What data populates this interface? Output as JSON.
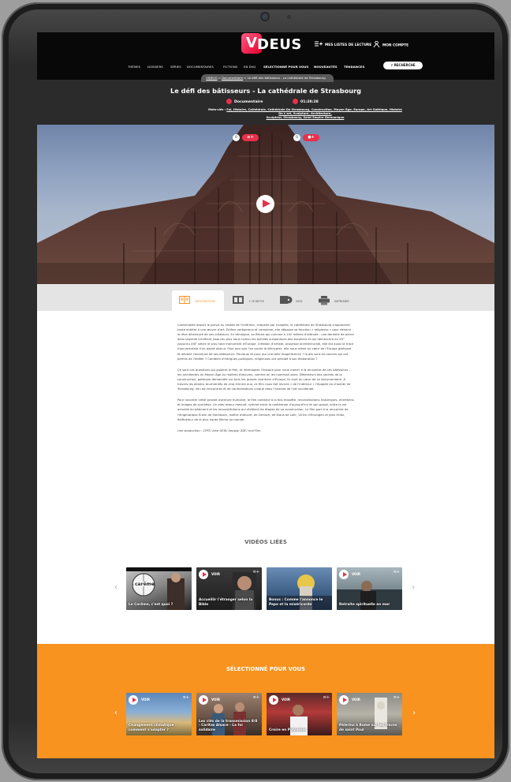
{
  "header": {
    "brand": "VIDEUS",
    "brand_letter": "V",
    "brand_rest": "DEUS",
    "playlists_label": "MES LISTES DE LECTURE",
    "account_label": "MON COMPTE",
    "search_label": "RECHERCHE",
    "nav": [
      "THÈMES",
      "DOSSIERS",
      "SÉRIES",
      "DOCUMENTAIRES",
      "FICTIONS",
      "EN DVD",
      "SÉLECTIONNÉ POUR VOUS",
      "NOUVEAUTÉS",
      "TENDANCES"
    ]
  },
  "breadcrumb": {
    "home": "VIDEUS",
    "sep1": " > ",
    "section": "Documentaire",
    "sep2": " > ",
    "current": "Le défi des bâtisseurs - La cathédrale de Strasbourg"
  },
  "video": {
    "title": "Le défi des bâtisseurs - La cathédrale de Strasbourg",
    "genre": "Documentaire",
    "duration": "01:28:28",
    "keywords_label": "Mots-clés :",
    "keywords_line1": "Foi, Histoire, Cathédrale, Cathédrale De Strasbourg, Construction, Moyen Âge, Europe, Art Gothique, Histoire De L'art, Sculpture, Architecture,",
    "keywords_line2": "Sculpteur, Strasbourg, Saint Empire Germanique",
    "playlist_count": "0",
    "share_count": "0"
  },
  "tabs": [
    {
      "label": "DESCRIPTION",
      "icon": "book-icon"
    },
    {
      "label": "+ D'INFOS",
      "icon": "film-strip-icon"
    },
    {
      "label": "DVD",
      "icon": "dvd-icon"
    },
    {
      "label": "IMPRIMER",
      "icon": "printer-icon"
    }
  ],
  "description": {
    "p1": "Contemplée depuis le parvis ou visitée de l'intérieur, chapelle par chapelle, la cathédrale de Strasbourg s'apparente toute entière à une œuvre d'art. Édifice vertigineux et complexe, elle dépasse sa fonction « religieuse » pour devenir le rêve démesuré de ses créateurs. En témoigne, sa flèche qui culmine à 142 mètres d'altitude : une dentelle de pierre dans laquelle s'enfilent jusqu'au plus haut niveau les spirales suspendues des escaliers et qui demeurera du XVᵉ jusqu'au XIXᵉ siècle le plus haut monument d'Europe. Création d'artiste, prouesse architecturale, elle est aussi la trace monumentale d'un passé obscur. Pour peu que l'on sache la décrypter, elle nous mène au cœur de l'Europe gothique et dévoile l'aventure de ses bâtisseurs. Pourquoi et pour qui une telle magnificence ? Quels sont les savoirs qui ont permis de l'édifier ? Combien d'intrigues politiques, religieuses ont présidé à son élaboration ?",
    "p2": "Ce sont ces questions qui guident le film, et interrogent l'histoire pour nous mener à la rencontre de ses bâtisseurs : les architectes du Moyen Âge ou maîtres d'œuvres, comme on les nommait alors. Détenteurs des secrets de la construction, gothique demandée sur tous les grands chantiers d'Europe, ils sont au cœur de ce documentaire. À travers les destins tourmentés de cinq d'entre eux, ce film nous fait revivre « de l'intérieur » l'épopée du chantier de Strasbourg, lieu de rencontres et de confrontations unique dans l'histoire de l'art occidental.",
    "p3": "Pour raconter cette grande aventure humaine, le film combine à la fois enquête, reconstitutions historiques, entretiens et images de synthèse. Un aller-retour mesuré, rythmé entre la cathédrale d'aujourd'hui et son passé, entre la vie actuelle du bâtiment et les reconstitutions qui révèlent les étapes de sa construction. Le film part à la rencontre de l'énigmatique Erwin de Steinbach, maître d'œuvre, de Gerlach, de Klaus de Lohr, Ulrich d'Ensingen et Jean Hültz, édificateur de la plus haute flèche du monde.",
    "p4": "Une production : CFRT/ Arte GEIE/ Seppia/ ZDF/ Indi Film"
  },
  "related": {
    "title": "VIDÉOS LIÉES",
    "cards": [
      {
        "title": "Le Carême, c'est quoi ?",
        "voir": "",
        "tag": "careme"
      },
      {
        "title": "Accueillir l'étranger selon la Bible",
        "voir": "VOIR"
      },
      {
        "title": "Bonus : Comme l'annonce le Pape et la miséricorde",
        "voir": ""
      },
      {
        "title": "Retraite spirituelle en mer",
        "voir": "VOIR"
      }
    ]
  },
  "selected": {
    "title": "SÉLECTIONNÉ POUR VOUS",
    "cards": [
      {
        "title": "Changement climatique : comment s'adapter ?",
        "voir": "VOIR"
      },
      {
        "title": "Les clés de la transmission 8/8 - Caritas Alsace - La foi solidaire",
        "voir": "VOIR"
      },
      {
        "title": "Croire en Polynésie",
        "voir": "VOIR"
      },
      {
        "title": "Pèlerins à Rome sur les traces de saint Paul",
        "voir": "VOIR"
      }
    ]
  },
  "colors": {
    "accent": "#e8314a",
    "orange": "#f7931e",
    "dark": "#080808",
    "band": "#2b2b2b"
  }
}
